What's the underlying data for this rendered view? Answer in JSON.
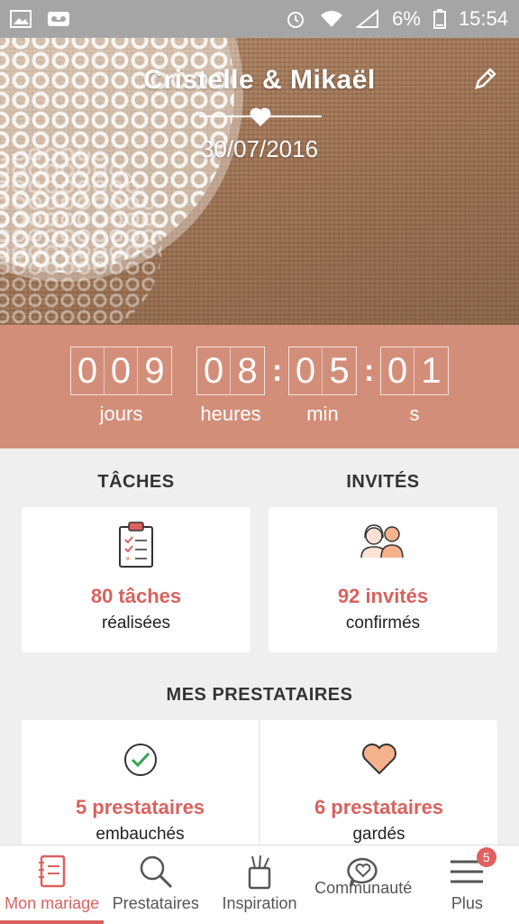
{
  "status_bar": {
    "battery": "6%",
    "time": "15:54"
  },
  "hero": {
    "couple": "Cristelle & Mikaël",
    "date": "30/07/2016"
  },
  "countdown": {
    "days": [
      "0",
      "0",
      "9"
    ],
    "hours": [
      "0",
      "8"
    ],
    "minutes": [
      "0",
      "5"
    ],
    "seconds": [
      "0",
      "1"
    ],
    "separator": ":",
    "labels": {
      "days": "jours",
      "hours": "heures",
      "minutes": "min",
      "seconds": "s"
    }
  },
  "tasks": {
    "title": "TÂCHES",
    "count": "80 tâches",
    "sub": "réalisées"
  },
  "guests": {
    "title": "INVITÉS",
    "count": "92 invités",
    "sub": "confirmés"
  },
  "vendors": {
    "title": "MES PRESTATAIRES",
    "hired": {
      "count": "5 prestataires",
      "sub": "embauchés"
    },
    "saved": {
      "count": "6 prestataires",
      "sub": "gardés"
    }
  },
  "nav": {
    "items": [
      {
        "label": "Mon mariage",
        "icon": "notebook-icon"
      },
      {
        "label": "Prestataires",
        "icon": "search-icon"
      },
      {
        "label": "Inspiration",
        "icon": "paint-cup-icon"
      },
      {
        "label": "Communauté",
        "icon": "heart-bubble-icon"
      },
      {
        "label": "Plus",
        "icon": "menu-icon"
      }
    ],
    "badge": "5"
  },
  "colors": {
    "accent": "#d9625e",
    "countdown_bg": "#d38e79",
    "status_bar": "#a5a5a5"
  }
}
